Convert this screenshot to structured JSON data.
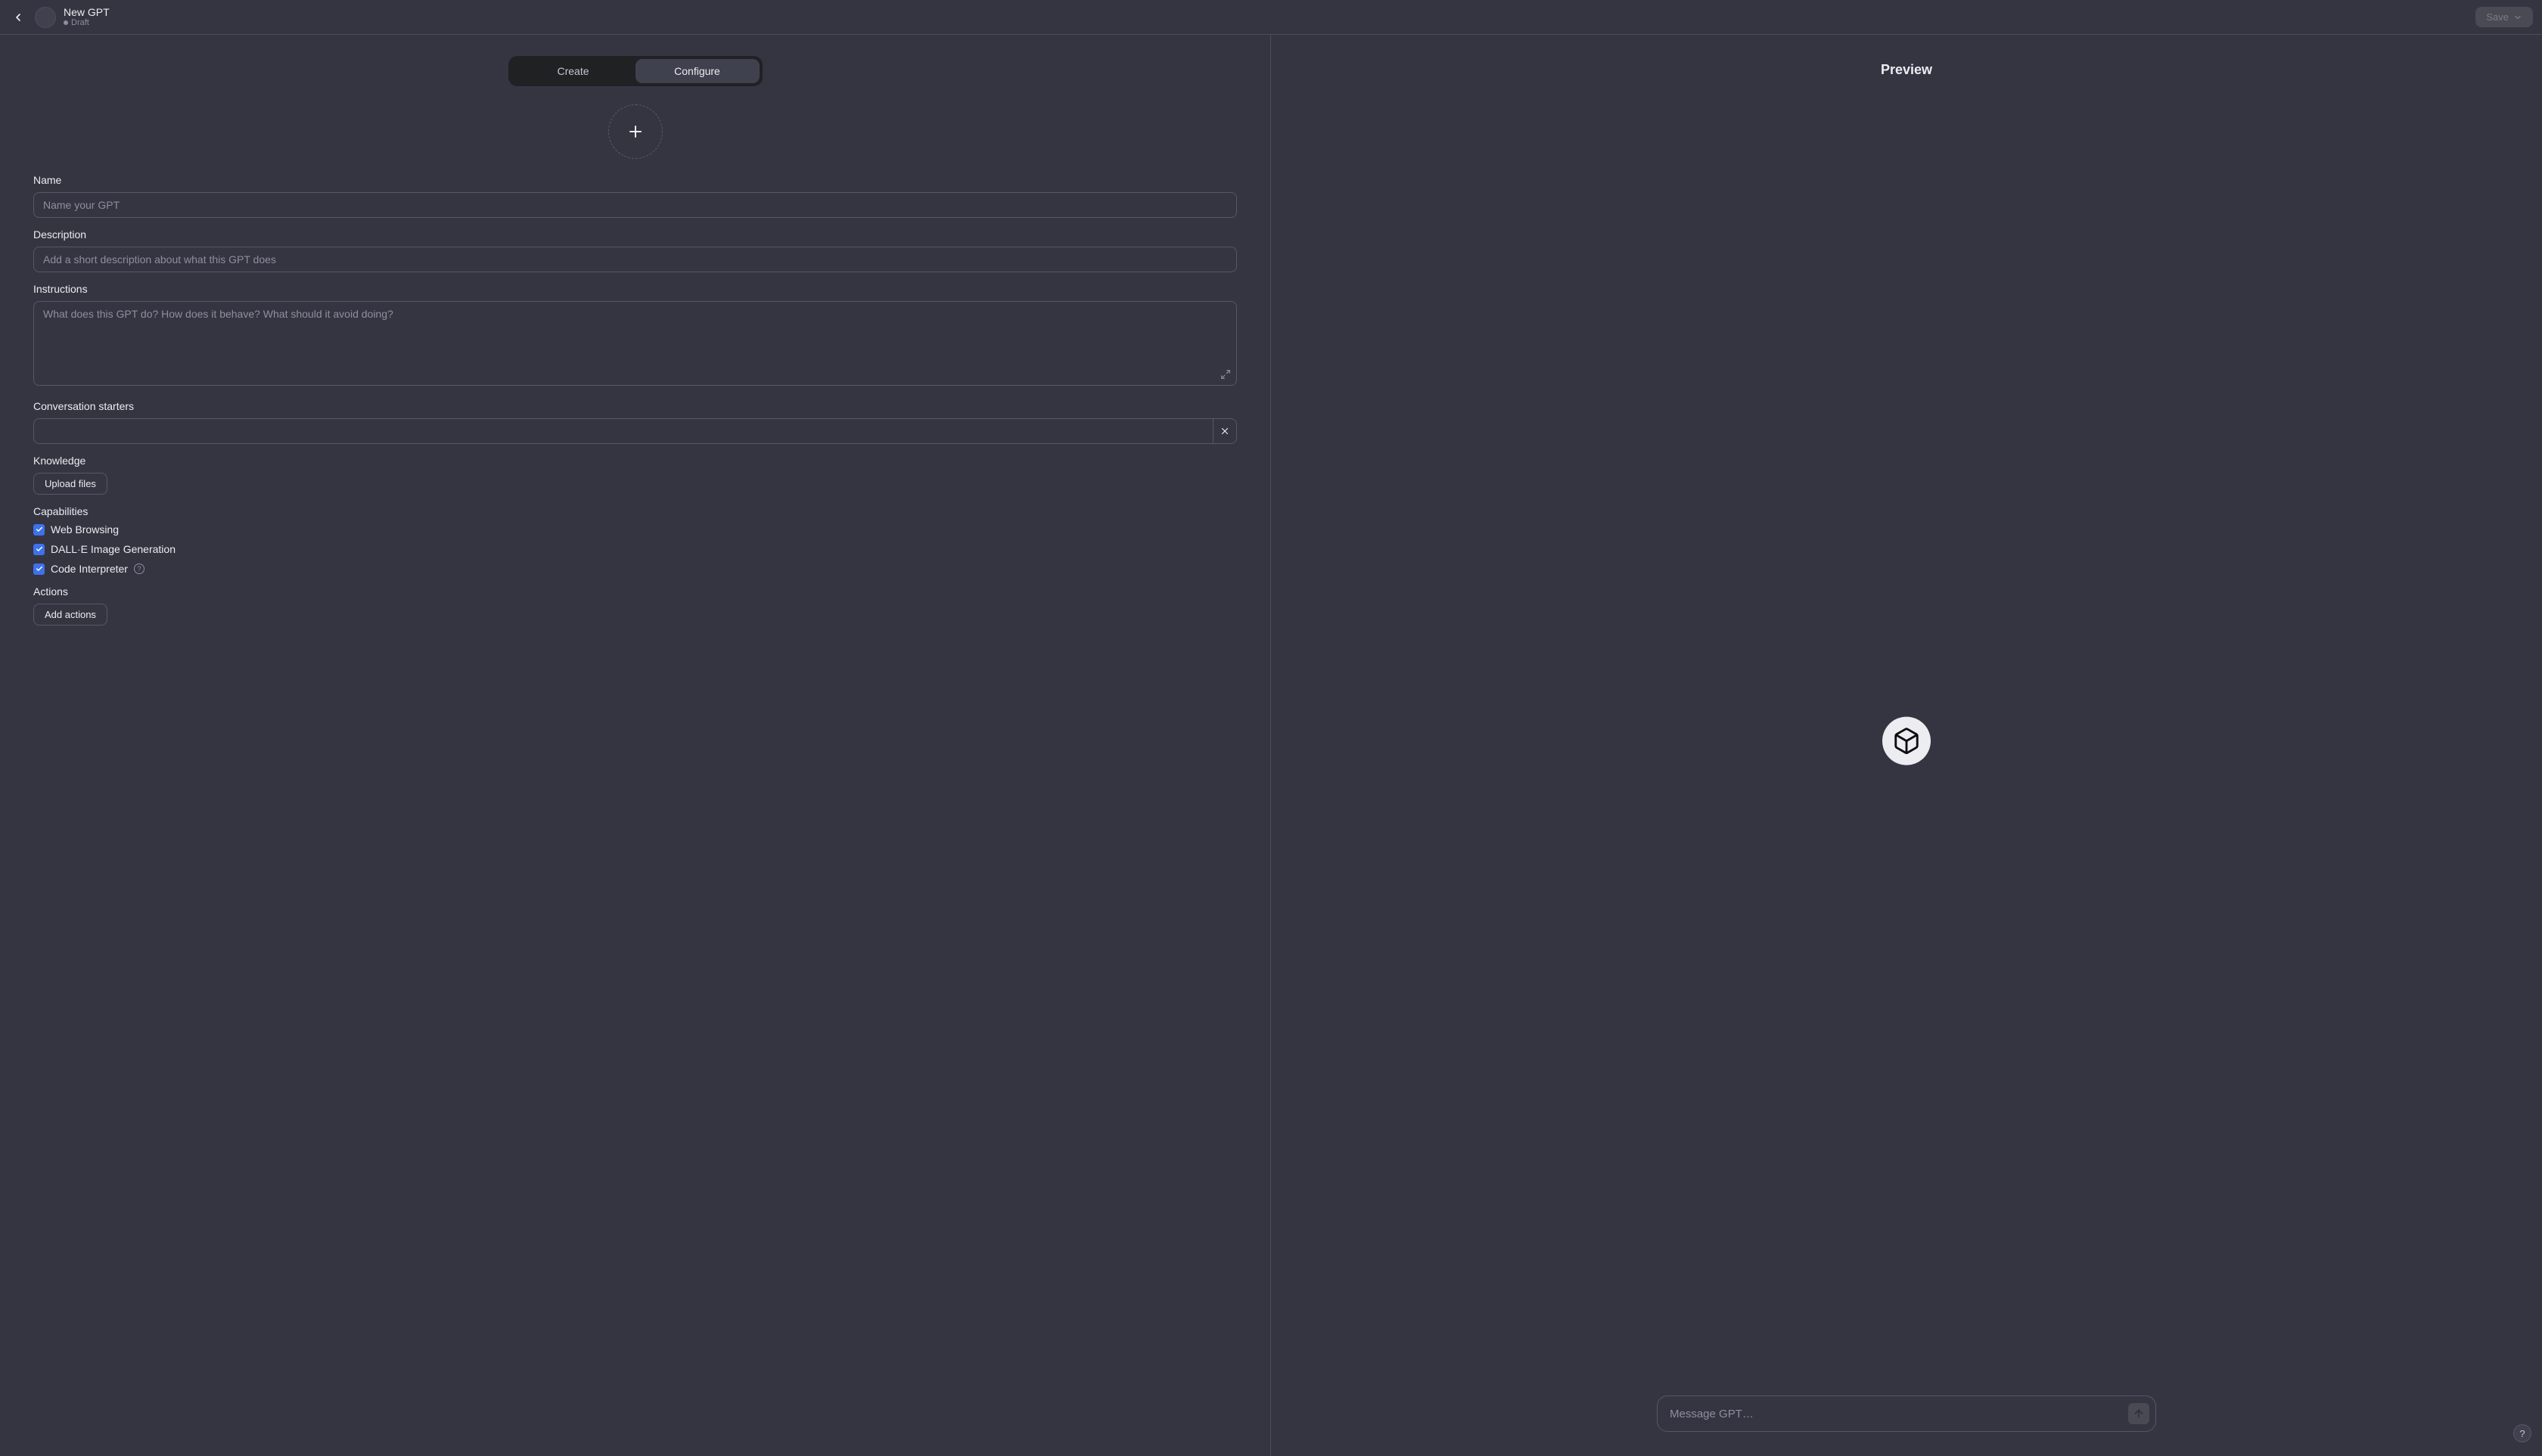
{
  "header": {
    "title": "New GPT",
    "status": "Draft",
    "save_label": "Save"
  },
  "tabs": {
    "create": "Create",
    "configure": "Configure"
  },
  "form": {
    "name_label": "Name",
    "name_placeholder": "Name your GPT",
    "name_value": "",
    "description_label": "Description",
    "description_placeholder": "Add a short description about what this GPT does",
    "description_value": "",
    "instructions_label": "Instructions",
    "instructions_placeholder": "What does this GPT do? How does it behave? What should it avoid doing?",
    "instructions_value": "",
    "starters_label": "Conversation starters",
    "starter_value": "",
    "knowledge_label": "Knowledge",
    "upload_label": "Upload files",
    "capabilities_label": "Capabilities",
    "capabilities": [
      {
        "label": "Web Browsing",
        "checked": true
      },
      {
        "label": "DALL·E Image Generation",
        "checked": true
      },
      {
        "label": "Code Interpreter",
        "checked": true,
        "info": true
      }
    ],
    "actions_label": "Actions",
    "add_actions_label": "Add actions"
  },
  "preview": {
    "title": "Preview",
    "message_placeholder": "Message GPT…"
  },
  "help": "?"
}
